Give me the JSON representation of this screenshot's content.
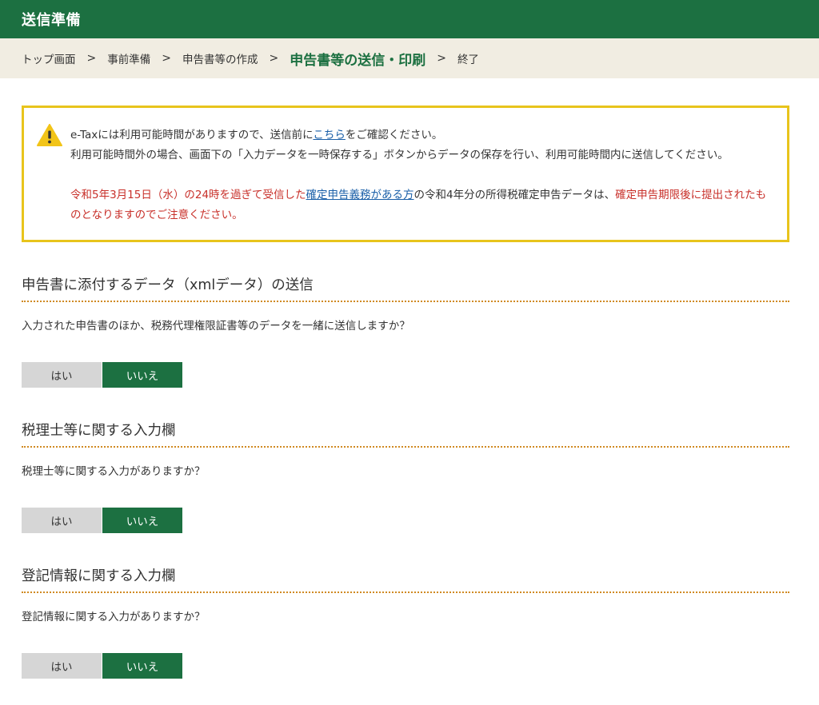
{
  "header": {
    "title": "送信準備"
  },
  "breadcrumb": {
    "items": [
      "トップ画面",
      "事前準備",
      "申告書等の作成",
      "申告書等の送信・印刷",
      "終了"
    ],
    "separator": ">"
  },
  "notice": {
    "line1_a": "e-Taxには利用可能時間がありますので、送信前に",
    "line1_link": "こちら",
    "line1_b": "をご確認ください。",
    "line2": "利用可能時間外の場合、画面下の「入力データを一時保存する」ボタンからデータの保存を行い、利用可能時間内に送信してください。",
    "line3_red_a": "令和5年3月15日（水）の24時を過ぎて受信した",
    "line3_link": "確定申告義務がある方",
    "line3_mid": "の令和4年分の所得税確定申告データは、",
    "line3_red_b": "確定申告期限後に提出されたものとなりますのでご注意ください。"
  },
  "sections": [
    {
      "title": "申告書に添付するデータ（xmlデータ）の送信",
      "question": "入力された申告書のほか、税務代理権限証書等のデータを一緒に送信しますか？",
      "yes": "はい",
      "no": "いいえ"
    },
    {
      "title": "税理士等に関する入力欄",
      "question": "税理士等に関する入力がありますか？",
      "yes": "はい",
      "no": "いいえ"
    },
    {
      "title": "登記情報に関する入力欄",
      "question": "登記情報に関する入力がありますか？",
      "yes": "はい",
      "no": "いいえ"
    }
  ],
  "colors": {
    "brand_green": "#1c7041",
    "breadcrumb_bg": "#f1ede2",
    "notice_border": "#e8c41c",
    "warning_red": "#c8302a",
    "link_blue": "#1a5fa8",
    "divider_orange": "#d08a22"
  },
  "icons": {
    "notice": "warning-icon",
    "breadcrumb_separator": "chevron-right-icon"
  }
}
